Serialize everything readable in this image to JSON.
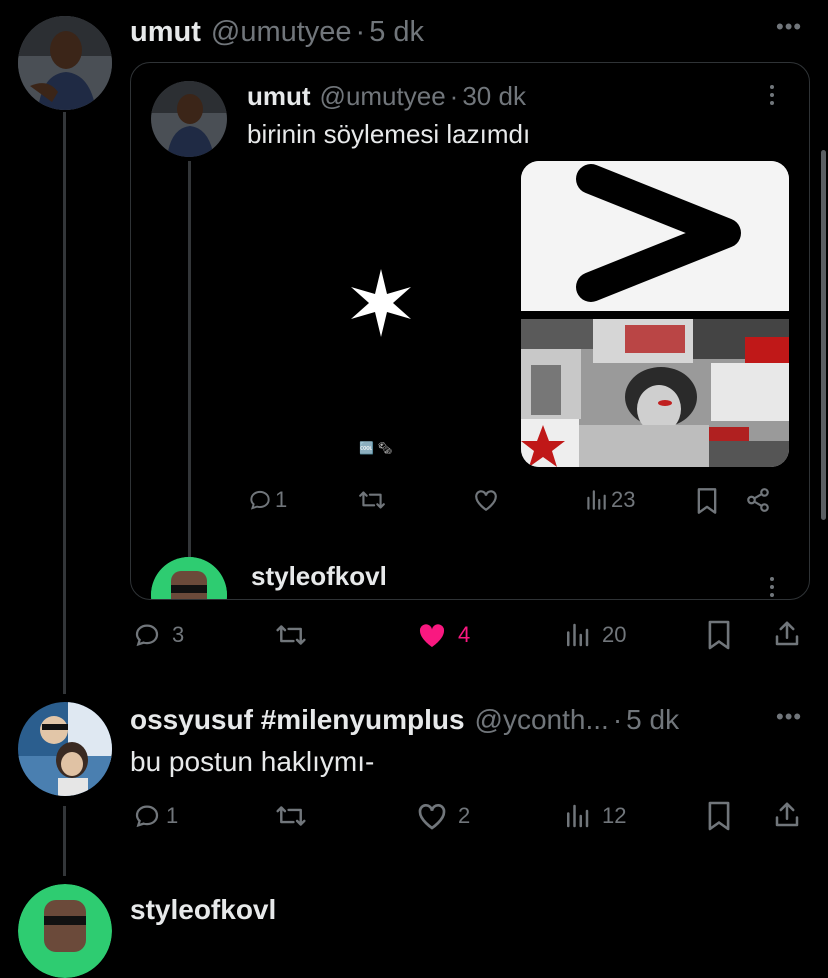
{
  "main_post": {
    "display_name": "umut",
    "handle": "@umutyee",
    "separator": "·",
    "time": "5 dk",
    "actions": {
      "likes": "4",
      "replies": "3",
      "views": "20"
    }
  },
  "quoted_post": {
    "display_name": "umut",
    "handle": "@umutyee",
    "separator": "·",
    "time": "30 dk",
    "text": "birinin söylemesi lazımdı",
    "actions": {
      "replies": "1",
      "views": "23"
    },
    "small_caption": "🆒 🗞",
    "nested_reply_name": "styleofkovl"
  },
  "reply_post": {
    "display_name": "ossyusuf #milenyumplus",
    "handle": "@yconth...",
    "separator": "·",
    "time": "5 dk",
    "text": "bu postun haklıymı-",
    "actions": {
      "replies": "1",
      "likes": "2",
      "views": "12"
    }
  },
  "next_post": {
    "display_name": "styleofkovl"
  },
  "colors": {
    "like_active": "#f91880",
    "muted": "#71767b",
    "avatar_ring": "#2ecc71"
  }
}
